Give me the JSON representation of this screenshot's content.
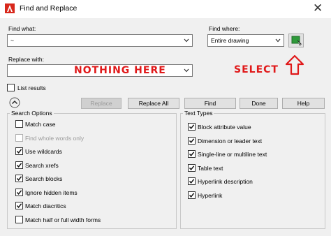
{
  "window": {
    "title": "Find and Replace",
    "close": "✕"
  },
  "find_what": {
    "label": "Find what:",
    "value": "~"
  },
  "find_where": {
    "label": "Find where:",
    "value": "Entire drawing"
  },
  "replace_with": {
    "label": "Replace with:",
    "value": ""
  },
  "annotations": {
    "nothing_here": "NOTHING HERE",
    "select": "SELECT",
    "color": "#e0191a"
  },
  "list_results": {
    "label": "List results",
    "checked": false
  },
  "buttons": {
    "replace": "Replace",
    "replace_all": "Replace All",
    "find": "Find",
    "done": "Done",
    "help": "Help"
  },
  "search_options": {
    "title": "Search Options",
    "items": [
      {
        "label": "Match case",
        "checked": false,
        "enabled": true
      },
      {
        "label": "Find whole words only",
        "checked": false,
        "enabled": false
      },
      {
        "label": "Use wildcards",
        "checked": true,
        "enabled": true
      },
      {
        "label": "Search xrefs",
        "checked": true,
        "enabled": true
      },
      {
        "label": "Search blocks",
        "checked": true,
        "enabled": true
      },
      {
        "label": "Ignore hidden items",
        "checked": true,
        "enabled": true
      },
      {
        "label": "Match diacritics",
        "checked": true,
        "enabled": true
      },
      {
        "label": "Match half or full width forms",
        "checked": false,
        "enabled": true
      }
    ]
  },
  "text_types": {
    "title": "Text Types",
    "items": [
      {
        "label": "Block attribute value",
        "checked": true
      },
      {
        "label": "Dimension or leader text",
        "checked": true
      },
      {
        "label": "Single-line or multiline text",
        "checked": true
      },
      {
        "label": "Table text",
        "checked": true
      },
      {
        "label": "Hyperlink description",
        "checked": true
      },
      {
        "label": "Hyperlink",
        "checked": true
      }
    ]
  }
}
